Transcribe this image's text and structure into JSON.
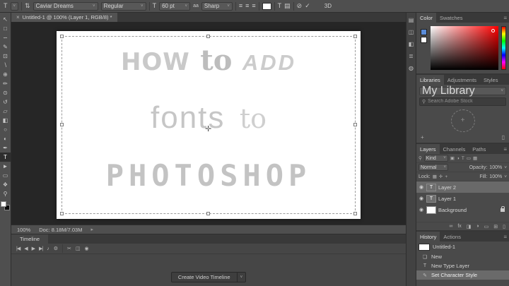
{
  "icons": {
    "tool_preset": "T",
    "orientation": "⇅",
    "size": "T",
    "anti_alias": "aa",
    "align_left": "≡",
    "align_center": "≡",
    "align_right": "≡",
    "warp": "T",
    "panels": "▤",
    "cancel": "⊘",
    "commit": "✓",
    "menu": "≡",
    "chevron": "˅",
    "close": "×",
    "search": "⚲",
    "eye": "◉",
    "plus": "+",
    "trash": "▯",
    "flyout": "▸",
    "crosshair": "✛",
    "dropzone_plus": "+"
  },
  "options_bar": {
    "font_family": "Caviar Dreams",
    "font_style": "Regular",
    "font_size": "60 pt",
    "anti_alias": "Sharp",
    "threed": "3D"
  },
  "document_tab": {
    "title": "Untitled-1 @ 100% (Layer 1, RGB/8) *"
  },
  "toolbar": {
    "tools": [
      {
        "name": "move-tool",
        "glyph": "↖"
      },
      {
        "name": "marquee-tool",
        "glyph": "□"
      },
      {
        "name": "lasso-tool",
        "glyph": "∽"
      },
      {
        "name": "quick-selection-tool",
        "glyph": "✎"
      },
      {
        "name": "crop-tool",
        "glyph": "⊡"
      },
      {
        "name": "eyedropper-tool",
        "glyph": "∖"
      },
      {
        "name": "healing-brush-tool",
        "glyph": "⊕"
      },
      {
        "name": "brush-tool",
        "glyph": "✏"
      },
      {
        "name": "clone-stamp-tool",
        "glyph": "⊙"
      },
      {
        "name": "history-brush-tool",
        "glyph": "↺"
      },
      {
        "name": "eraser-tool",
        "glyph": "▱"
      },
      {
        "name": "gradient-tool",
        "glyph": "◧"
      },
      {
        "name": "blur-tool",
        "glyph": "○"
      },
      {
        "name": "dodge-tool",
        "glyph": "◐"
      },
      {
        "name": "pen-tool",
        "glyph": "✒"
      },
      {
        "name": "type-tool",
        "glyph": "T"
      },
      {
        "name": "path-selection-tool",
        "glyph": "►"
      },
      {
        "name": "shape-tool",
        "glyph": "▭"
      },
      {
        "name": "hand-tool",
        "glyph": "❖"
      },
      {
        "name": "zoom-tool",
        "glyph": "⚲"
      }
    ]
  },
  "canvas": {
    "lines": [
      {
        "segments": [
          "HOW",
          "to",
          "ADD"
        ]
      },
      {
        "segments": [
          "fonts",
          "to"
        ]
      },
      {
        "segments": [
          "PHOTOSHOP"
        ]
      }
    ]
  },
  "status_bar": {
    "zoom": "100%",
    "doc": "Doc: 8.18M/7.03M"
  },
  "timeline": {
    "tab": "Timeline",
    "transport": [
      "|◀",
      "◀",
      "▶",
      "▶|"
    ],
    "audio": "♪",
    "gear": "⚙",
    "scissors": "✂",
    "transition": "◫",
    "camera": "◉",
    "create_button": "Create Video Timeline"
  },
  "right_strip": {
    "icons": [
      "▤",
      "◫",
      "◧",
      "≣",
      "◍"
    ]
  },
  "panels": {
    "color": {
      "tabs": [
        "Color",
        "Swatches"
      ]
    },
    "libraries": {
      "tabs": [
        "Libraries",
        "Adjustments",
        "Styles"
      ],
      "dropdown": "My Library",
      "search_placeholder": "Search Adobe Stock"
    },
    "layers": {
      "tabs": [
        "Layers",
        "Channels",
        "Paths"
      ],
      "kind": "Kind",
      "kind_icons": [
        "▣",
        "◑",
        "T",
        "▭",
        "▦"
      ],
      "blend_mode": "Normal",
      "opacity_label": "Opacity:",
      "opacity": "100%",
      "lock_label": "Lock:",
      "lock_icons": [
        "▦",
        "✛",
        "+"
      ],
      "fill_label": "Fill:",
      "fill": "100%",
      "rows": [
        {
          "name": "Layer 2",
          "thumb": "T"
        },
        {
          "name": "Layer 1",
          "thumb": "T"
        },
        {
          "name": "Background",
          "thumb": ""
        }
      ],
      "foot_icons": [
        "∞",
        "fx",
        "◨",
        "◑",
        "▭",
        "⊞",
        "▯"
      ]
    },
    "history": {
      "tabs": [
        "History",
        "Actions"
      ],
      "snapshot": "Untitled-1",
      "items": [
        {
          "label": "New",
          "icon": "❏"
        },
        {
          "label": "New Type Layer",
          "icon": "T"
        },
        {
          "label": "Set Character Style",
          "icon": "✎"
        }
      ]
    }
  },
  "colors": {
    "foreground_chip": "#5b8dd9",
    "background_chip": "#ffffff",
    "selected_hue": "#ff0000",
    "text_color_swatch": "#ffffff",
    "canvas_text": "#c5c5c5",
    "ui_dark": "#2e2e2e",
    "ui_mid": "#4a4a4a"
  }
}
